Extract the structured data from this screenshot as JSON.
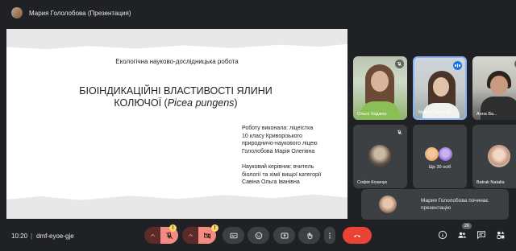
{
  "header": {
    "title": "Мария Гололобова (Презентация)"
  },
  "slide": {
    "subtitle": "Екологічна науково-дослідницька робота",
    "title_line1": "БІОІНДИКАЦІЙНІ ВЛАСТИВОСТІ ЯЛИНИ",
    "title_line2_plain": "КОЛЮЧОЇ (",
    "title_line2_italic": "Picea pungens",
    "title_line2_end": ")",
    "author_lines": [
      "Роботу виконала: ліцеїстка",
      "10 класу Криворізького",
      "природничо-наукового ліцею",
      "Гололобова Марія Олегівна"
    ],
    "supervisor_lines": [
      "Науковий керівник: вчитель",
      "біології та хімії вищої категорії",
      "Савіна Ольга Іванівна"
    ]
  },
  "participants": [
    {
      "name": "Ольга Ходжна",
      "muted": true
    },
    {
      "name": "Мария Гололоб...",
      "speaking": true
    },
    {
      "name": "Анна Ва...",
      "muted": true
    },
    {
      "name": "Софія Козачук",
      "muted": true
    },
    {
      "name": "Ще 20 осіб"
    },
    {
      "name": "Batrak Natalia",
      "muted": true
    }
  ],
  "toast": {
    "text": "Мария Гололобова починає презентацію"
  },
  "bottom": {
    "time": "10:20",
    "separator": "|",
    "meeting_code": "dmf-eyoe-gje",
    "warning_symbol": "!",
    "people_count": "26"
  },
  "colors": {
    "accent_blue": "#1a73e8",
    "hangup_red": "#ea4335",
    "off_red": "#f28b82",
    "warning_yellow": "#fdd663"
  }
}
